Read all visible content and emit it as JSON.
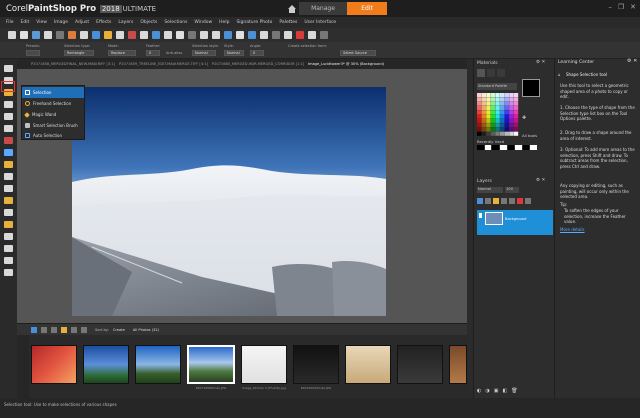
{
  "app": {
    "title_brand": "Corel",
    "title_name": "PaintShop Pro",
    "title_version": "2018",
    "title_edition": "ULTIMATE"
  },
  "workspace_tabs": {
    "manage": "Manage",
    "edit": "Edit"
  },
  "window_controls": [
    "–",
    "❐",
    "✕"
  ],
  "menu": [
    "File",
    "Edit",
    "View",
    "Image",
    "Adjust",
    "Effects",
    "Layers",
    "Objects",
    "Selections",
    "Window",
    "Help",
    "Signature Photo",
    "Palettes",
    "User Interface"
  ],
  "tool_options": {
    "labels": [
      "Presets:",
      "Selection type:",
      "Mode:",
      "Feather:",
      "Selection style:",
      "Style:",
      "Angle:",
      "Create selection from:"
    ],
    "values": [
      "",
      "Rectangle",
      "Replace",
      "0",
      "Normal",
      "Normal",
      "0",
      "Select Source"
    ],
    "checkbox_label": "Anti-alias"
  },
  "doc_tabs": [
    "P2071658_MERGEDFINAL_NEW.MAW.RIFF [3:1]",
    "P2071659_TREELINE_EDIT.MAW.MERGE.TIFF [4:1]",
    "P2071660_MERGED.HDR.MERGED_CORRIDOR [1:1]",
    "Image_Lucidtower3* @ 30% (Background)"
  ],
  "flyout": {
    "items": [
      "Selection",
      "Freehand Selection",
      "Magic Wand",
      "Smart Selection Brush",
      "Auto Selection"
    ]
  },
  "materials": {
    "title": "Materials",
    "dropdown": "Standard Palette",
    "all_tools": "All tools",
    "recent_label": "Recently Used"
  },
  "layers": {
    "title": "Layers",
    "blend": "Normal",
    "opacity": "100",
    "layer_name": "Background"
  },
  "learning": {
    "title": "Learning Center",
    "heading": "Shape Selection tool",
    "intro": "Use this tool to select a geometric shaped area of a photo to copy or edit.",
    "steps": [
      "1. Choose the type of shape from the Selection type list box on the Tool Options palette.",
      "2. Drag to draw a shape around the area of interest.",
      "3. Optional: To add more areas to the selection, press Shift and draw. To subtract areas from the selection, press Ctrl and draw."
    ],
    "after": "Any copying or editing, such as painting, will occur only within the selected area.",
    "tip_label": "Tip:",
    "tip": "To soften the edges of your selection, increase the Feather value.",
    "more": "More details"
  },
  "organizer": {
    "sort_label": "Sort by:",
    "sort_value": "Create",
    "filter_value": "All Photos (32)",
    "captions": [
      "",
      "",
      "",
      "P2071658(Final).JPG",
      "Image_kitchen 3 (Thumb).jpg",
      "P2070004(Final).JPG",
      "",
      "",
      ""
    ]
  },
  "status": {
    "text": "Selection tool: Use to make selections of various shapes"
  },
  "colors": {
    "accent": "#f07c1b",
    "selection_blue": "#1f6fb8",
    "highlight_red": "#e03030"
  }
}
